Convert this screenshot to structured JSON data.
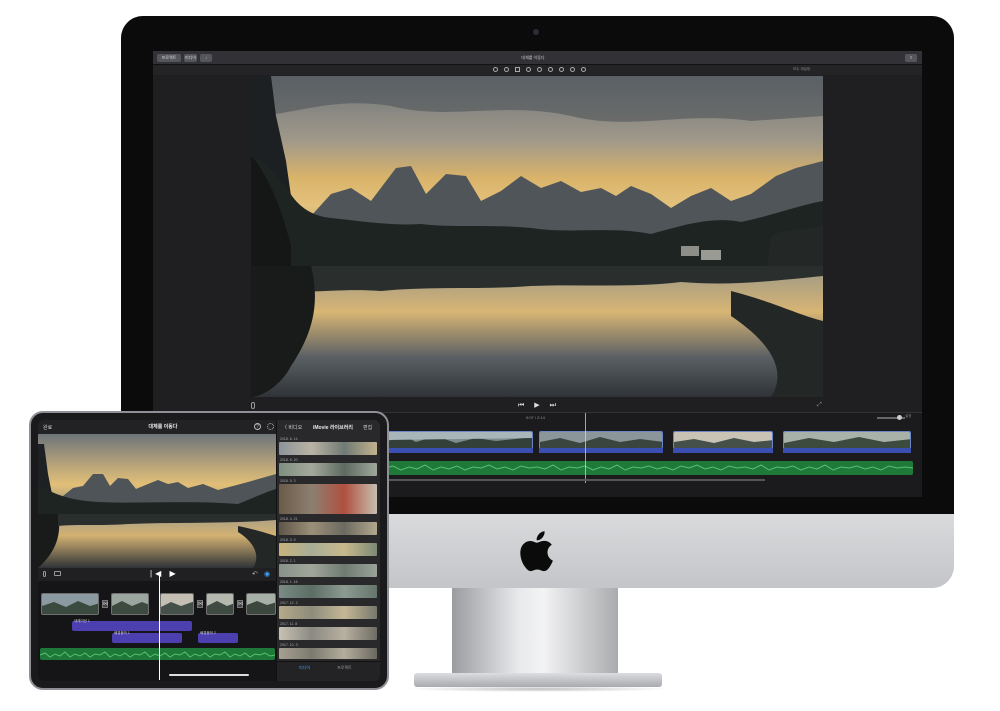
{
  "colors": {
    "accent": "#3aa3ff",
    "audio_green": "#1f7a3a",
    "audio_purple": "#4c3fb0",
    "clip_blue": "#3b4fb3"
  },
  "mac": {
    "toolbar": {
      "left_buttons": [
        "프로젝트",
        "미디어",
        "↓"
      ],
      "title": "대체를 이동다",
      "right_button": "⇪"
    },
    "inspector": {
      "icons": [
        "color-balance-icon",
        "color-correction-icon",
        "crop-icon",
        "stabilization-icon",
        "volume-icon",
        "noise-reduction-icon",
        "speed-icon",
        "filter-icon",
        "info-icon"
      ],
      "reset_label": "모두 재설정"
    },
    "playback": {
      "controls": "⏮ ▶ ⏭",
      "timecode": "0:07 / 2:14",
      "fullscreen": "⤢"
    },
    "timeline": {
      "settings_label": "설정",
      "clip_count": 5
    }
  },
  "ipad": {
    "topbar": {
      "done_label": "완료",
      "title": "대체를 이동다",
      "help_label": "?"
    },
    "controls": {
      "play": "|◀ ▶",
      "undo": "↶",
      "tools": "◉"
    },
    "timeline": {
      "transition_label": "⋈",
      "audio_labels": [
        "내레이션 1",
        "배경음악 1",
        "배경음악 2"
      ]
    },
    "browser": {
      "back_label": "〈 비디오",
      "title": "iMovie 라이브러리",
      "select_label": "편집",
      "dates": [
        "2018. 6. 14",
        "2018. 5. 20",
        "2018. 5. 3",
        "2018. 4. 21",
        "2018. 3. 9",
        "2018. 2. 1",
        "2018. 1. 16",
        "2017. 12. 2",
        "2017. 11. 8",
        "2017. 10. 3",
        "2017. 9. 14"
      ]
    },
    "tabbar": {
      "media_label": "미디어",
      "projects_label": "프로젝트"
    }
  }
}
